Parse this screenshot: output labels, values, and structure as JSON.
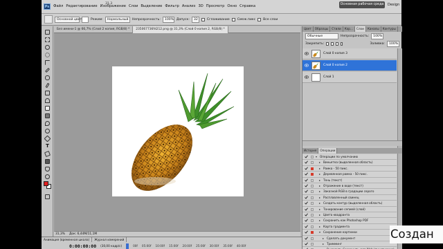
{
  "menubar": {
    "logo": "Ps",
    "items": [
      "Файл",
      "Редактирование",
      "Изображение",
      "Слои",
      "Выделение",
      "Фильтр",
      "Анализ",
      "3D",
      "Просмотр",
      "Окно",
      "Справка"
    ],
    "zoom_value": "31,3",
    "workspace_label": "Основная рабочая среда",
    "design_label": "Design"
  },
  "optionsbar": {
    "source": "Основной цвет",
    "mode_label": "Режим:",
    "mode_value": "Нормальный",
    "opacity_label": "Непрозрачность:",
    "opacity_value": "100%",
    "tolerance_label": "Допуск:",
    "tolerance_value": "32",
    "antialias_label": "Сглаживание",
    "contiguous_label": "Смеж.пикс",
    "all_layers_label": "Все слои"
  },
  "document": {
    "tabs": [
      "Без имени-1 @ 66,7% (Слой 2 копия, RGB/8) *",
      "235067736fd212.png @ 31,3% (Слой 0 копия 2, RGB/8) *"
    ],
    "status_zoom": "31,3%",
    "status_doc": "Док: 6,44М/11,1М"
  },
  "layers_panel": {
    "tabs": [
      "Цвет",
      "Образцы",
      "Стили",
      "Кор...",
      "Слои",
      "Каналы",
      "Контуры"
    ],
    "blend_mode": "Обычные",
    "opacity_label": "Непрозрачность:",
    "opacity_value": "100%",
    "lock_label": "Закрепить:",
    "fill_label": "Заливка:",
    "fill_value": "100%",
    "layers": [
      {
        "name": "Слой 0 копия 3",
        "selected": false
      },
      {
        "name": "Слой 0 копия 2",
        "selected": true
      },
      {
        "name": "Слой 1",
        "selected": false
      }
    ]
  },
  "actions_panel": {
    "tabs": [
      "История",
      "Операции"
    ],
    "items": [
      {
        "label": "Операции по умолчанию",
        "level": 0
      },
      {
        "label": "Виньетка (выделенная область)",
        "level": 1
      },
      {
        "label": "Рамка - 50 пикс.",
        "level": 1
      },
      {
        "label": "Деревянная рамка - 50 пикс.",
        "level": 1
      },
      {
        "label": "Тень (текст)",
        "level": 1
      },
      {
        "label": "Отражение в воде (текст)",
        "level": 1
      },
      {
        "label": "Заказной RGB в градации серого",
        "level": 1
      },
      {
        "label": "Расплавленный свинец",
        "level": 1
      },
      {
        "label": "Создать контур (выделенная область)",
        "level": 1
      },
      {
        "label": "Тонирование сепией (слой)",
        "level": 1
      },
      {
        "label": "Цвета квадранта",
        "level": 1
      },
      {
        "label": "Сохранить как Photoshop PDF",
        "level": 1
      },
      {
        "label": "Карта градиента",
        "level": 1
      },
      {
        "label": "Сохранение картинки",
        "level": 1
      },
      {
        "label": "Сделать документ",
        "level": 2
      },
      {
        "label": "Тримминг",
        "level": 2
      },
      {
        "label": "Выделить Сохранить для Web (пункт меню)",
        "level": 2
      }
    ]
  },
  "timeline": {
    "tabs": [
      "Анимация (временная шкала)",
      "Журнал измерений"
    ],
    "time": "0:00:00:00",
    "fps": "(30,00 кадр/с)",
    "marks": [
      "00f",
      "05:00f",
      "10:00f",
      "15:00f",
      "20:00f",
      "25:00f",
      "30:00f",
      "35:00f",
      "40:00f"
    ]
  },
  "caption": "Создан",
  "colors": {
    "selection_blue": "#2f73d8",
    "foreground": "#e02020",
    "background": "#ffffff"
  }
}
